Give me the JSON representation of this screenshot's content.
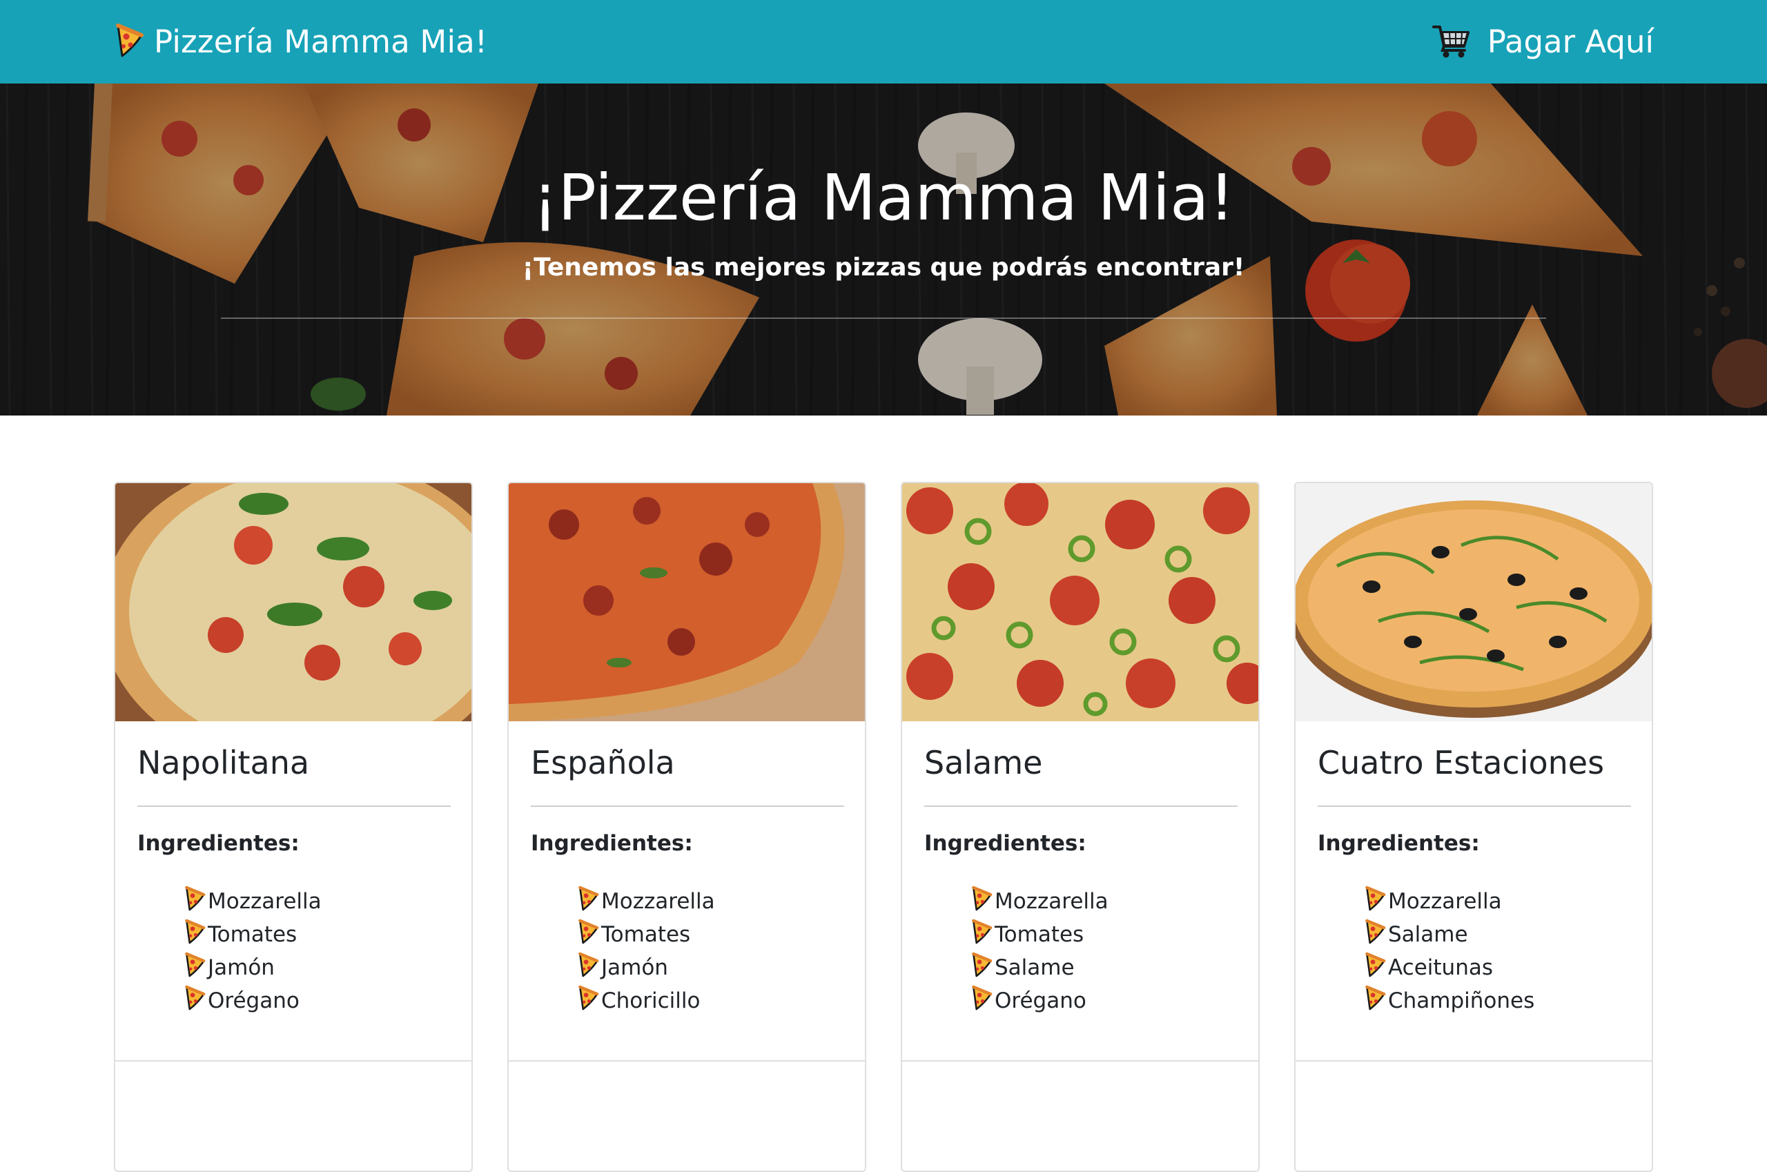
{
  "navbar": {
    "brand": "Pizzería Mamma Mia!",
    "brand_icon": "pizza-icon",
    "cart_label": "Pagar Aquí",
    "cart_icon": "shopping-cart-icon",
    "background": "#17a2b8"
  },
  "hero": {
    "title": "¡Pizzería Mamma Mia!",
    "subtitle": "¡Tenemos las mejores pizzas que podrás encontrar!"
  },
  "cards": [
    {
      "name": "Napolitana",
      "ingredients_label": "Ingredientes:",
      "ingredients": [
        "Mozzarella",
        "Tomates",
        "Jamón",
        "Orégano"
      ]
    },
    {
      "name": "Española",
      "ingredients_label": "Ingredientes:",
      "ingredients": [
        "Mozzarella",
        "Tomates",
        "Jamón",
        "Choricillo"
      ]
    },
    {
      "name": "Salame",
      "ingredients_label": "Ingredientes:",
      "ingredients": [
        "Mozzarella",
        "Tomates",
        "Salame",
        "Orégano"
      ]
    },
    {
      "name": "Cuatro Estaciones",
      "ingredients_label": "Ingredientes:",
      "ingredients": [
        "Mozzarella",
        "Salame",
        "Aceitunas",
        "Champiñones"
      ]
    }
  ]
}
